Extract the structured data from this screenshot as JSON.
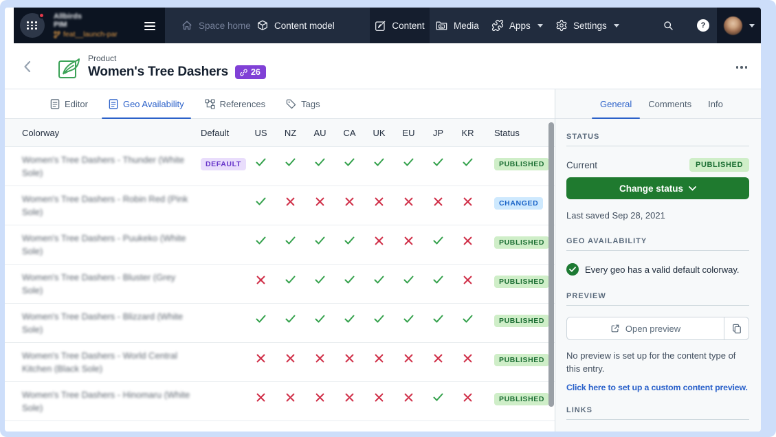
{
  "topbar": {
    "org_line1": "Allbirds",
    "org_line2": "PIM",
    "org_branch": "feat__launch-par",
    "nav": {
      "space_home": "Space home",
      "content_model": "Content model",
      "content": "Content",
      "media": "Media",
      "apps": "Apps",
      "settings": "Settings"
    },
    "help_label": "?"
  },
  "breadcrumb": {
    "type_label": "Product",
    "title": "Women's Tree Dashers",
    "ref_count": "26"
  },
  "main_tabs": {
    "editor": "Editor",
    "geo": "Geo Availability",
    "references": "References",
    "tags": "Tags"
  },
  "table": {
    "colorway_header": "Colorway",
    "default_header": "Default",
    "status_header": "Status",
    "geo_columns": [
      "US",
      "NZ",
      "AU",
      "CA",
      "UK",
      "EU",
      "JP",
      "KR"
    ],
    "default_badge": "DEFAULT",
    "rows": [
      {
        "name": "Women's Tree Dashers - Thunder (White Sole)",
        "default": true,
        "geo": [
          1,
          1,
          1,
          1,
          1,
          1,
          1,
          1
        ],
        "status": "PUBLISHED"
      },
      {
        "name": "Women's Tree Dashers - Robin Red (Pink Sole)",
        "default": false,
        "geo": [
          1,
          0,
          0,
          0,
          0,
          0,
          0,
          0
        ],
        "status": "CHANGED"
      },
      {
        "name": "Women's Tree Dashers - Puukeko (White Sole)",
        "default": false,
        "geo": [
          1,
          1,
          1,
          1,
          0,
          0,
          1,
          0
        ],
        "status": "PUBLISHED"
      },
      {
        "name": "Women's Tree Dashers - Bluster (Grey Sole)",
        "default": false,
        "geo": [
          0,
          1,
          1,
          1,
          1,
          1,
          1,
          0
        ],
        "status": "PUBLISHED"
      },
      {
        "name": "Women's Tree Dashers - Blizzard (White Sole)",
        "default": false,
        "geo": [
          1,
          1,
          1,
          1,
          1,
          1,
          1,
          1
        ],
        "status": "PUBLISHED"
      },
      {
        "name": "Women's Tree Dashers - World Central Kitchen (Black Sole)",
        "default": false,
        "geo": [
          0,
          0,
          0,
          0,
          0,
          0,
          0,
          0
        ],
        "status": "PUBLISHED"
      },
      {
        "name": "Women's Tree Dashers - Hinomaru (White Sole)",
        "default": false,
        "geo": [
          0,
          0,
          0,
          0,
          0,
          0,
          1,
          0
        ],
        "status": "PUBLISHED"
      }
    ]
  },
  "sidebar": {
    "tabs": {
      "general": "General",
      "comments": "Comments",
      "info": "Info"
    },
    "status": {
      "header": "STATUS",
      "current_label": "Current",
      "badge": "PUBLISHED",
      "button": "Change status",
      "last_saved": "Last saved Sep 28, 2021"
    },
    "geo": {
      "header": "GEO AVAILABILITY",
      "message": "Every geo has a valid default colorway."
    },
    "preview": {
      "header": "PREVIEW",
      "button": "Open preview",
      "note": "No preview is set up for the content type of this entry.",
      "link": "Click here to set up a custom content preview."
    },
    "links": {
      "header": "LINKS"
    }
  },
  "colors": {
    "accent_blue": "#2b61c9",
    "badge_purple": "#8040d6",
    "published_green": "#1b6e33",
    "changed_blue": "#1a64c8",
    "check_green": "#34a14c",
    "cross_red": "#d03049",
    "button_green": "#1f7a2f"
  }
}
